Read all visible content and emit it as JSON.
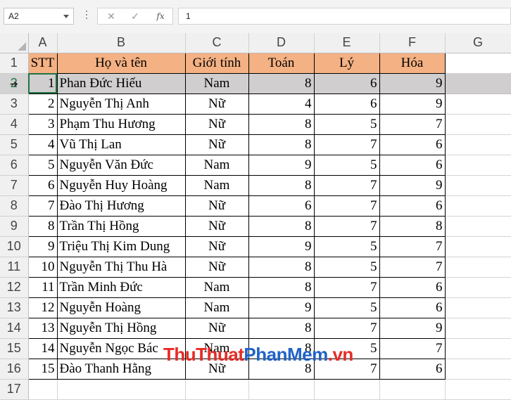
{
  "formula_bar": {
    "name_box": "A2",
    "cancel_icon": "close-icon",
    "enter_icon": "check-icon",
    "fx_label": "fx",
    "formula_value": "1"
  },
  "columns": [
    "A",
    "B",
    "C",
    "D",
    "E",
    "F",
    "G"
  ],
  "row_numbers": [
    "1",
    "2",
    "3",
    "4",
    "5",
    "6",
    "7",
    "8",
    "9",
    "10",
    "11",
    "12",
    "13",
    "14",
    "15",
    "16",
    "17"
  ],
  "selected_row": "2",
  "header_fill_color": "#f4b183",
  "selection_fill_color": "#d0cece",
  "headers": {
    "stt": "STT",
    "name": "Họ và tên",
    "gender": "Giới tính",
    "math": "Toán",
    "physics": "Lý",
    "chemistry": "Hóa"
  },
  "rows": [
    {
      "stt": "1",
      "name": "Phan Đức Hiếu",
      "gender": "Nam",
      "math": "8",
      "physics": "6",
      "chemistry": "9"
    },
    {
      "stt": "2",
      "name": "Nguyễn Thị Anh",
      "gender": "Nữ",
      "math": "4",
      "physics": "6",
      "chemistry": "9"
    },
    {
      "stt": "3",
      "name": "Phạm Thu Hương",
      "gender": "Nữ",
      "math": "8",
      "physics": "5",
      "chemistry": "7"
    },
    {
      "stt": "4",
      "name": "Vũ Thị Lan",
      "gender": "Nữ",
      "math": "8",
      "physics": "7",
      "chemistry": "6"
    },
    {
      "stt": "5",
      "name": "Nguyễn Văn Đức",
      "gender": "Nam",
      "math": "9",
      "physics": "5",
      "chemistry": "6"
    },
    {
      "stt": "6",
      "name": "Nguyễn Huy Hoàng",
      "gender": "Nam",
      "math": "8",
      "physics": "7",
      "chemistry": "9"
    },
    {
      "stt": "7",
      "name": "Đào Thị Hương",
      "gender": "Nữ",
      "math": "6",
      "physics": "7",
      "chemistry": "6"
    },
    {
      "stt": "8",
      "name": "Trần Thị Hồng",
      "gender": "Nữ",
      "math": "8",
      "physics": "7",
      "chemistry": "8"
    },
    {
      "stt": "9",
      "name": "Triệu Thị Kim Dung",
      "gender": "Nữ",
      "math": "9",
      "physics": "5",
      "chemistry": "7"
    },
    {
      "stt": "10",
      "name": "Nguyễn Thị Thu Hà",
      "gender": "Nữ",
      "math": "8",
      "physics": "5",
      "chemistry": "7"
    },
    {
      "stt": "11",
      "name": "Trần Minh Đức",
      "gender": "Nam",
      "math": "8",
      "physics": "7",
      "chemistry": "6"
    },
    {
      "stt": "12",
      "name": "Nguyễn Hoàng",
      "gender": "Nam",
      "math": "9",
      "physics": "5",
      "chemistry": "6"
    },
    {
      "stt": "13",
      "name": "Nguyễn Thị Hồng",
      "gender": "Nữ",
      "math": "8",
      "physics": "7",
      "chemistry": "9"
    },
    {
      "stt": "14",
      "name": "Nguyễn Ngọc Bác",
      "gender": "Nam",
      "math": "8",
      "physics": "5",
      "chemistry": "7"
    },
    {
      "stt": "15",
      "name": "Đào Thanh Hằng",
      "gender": "Nữ",
      "math": "8",
      "physics": "7",
      "chemistry": "6"
    }
  ],
  "watermark": {
    "part1": "Thu",
    "part2": "Thuat",
    "part3": "PhanMem",
    "part4": ".vn"
  }
}
